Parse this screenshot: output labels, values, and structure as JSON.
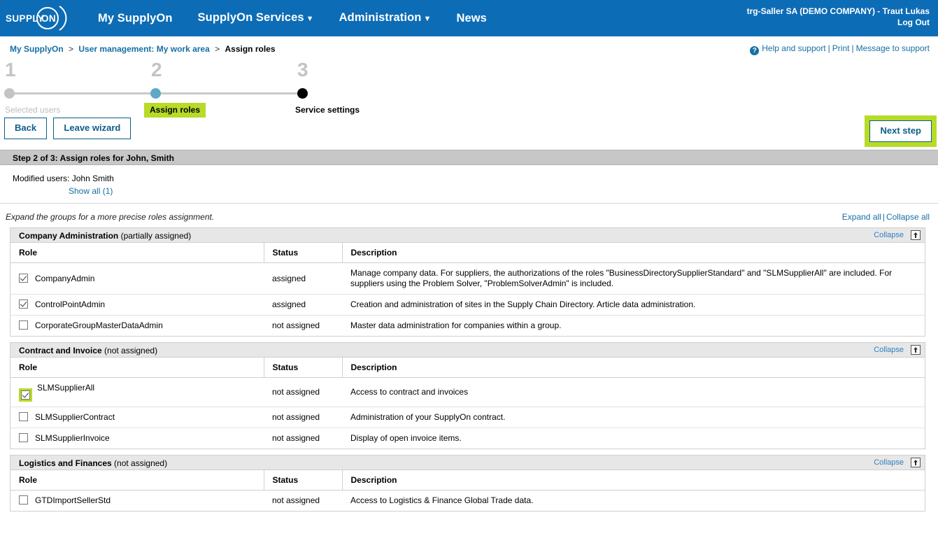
{
  "header": {
    "logo_text": "SUPPLYON",
    "logo_icon": "supplyon-logo",
    "nav": [
      {
        "label": "My SupplyOn",
        "has_caret": false
      },
      {
        "label": "SupplyOn Services",
        "has_caret": true
      },
      {
        "label": "Administration",
        "has_caret": true
      },
      {
        "label": "News",
        "has_caret": false
      }
    ],
    "user_line": "trg-Saller SA (DEMO COMPANY) - Traut Lukas",
    "logout_label": "Log Out",
    "brand_blue": "#0d6cb6"
  },
  "breadcrumb": {
    "items": [
      {
        "label": "My SupplyOn",
        "current": false
      },
      {
        "label": "User management: My work area",
        "current": false
      },
      {
        "label": "Assign roles",
        "current": true
      }
    ],
    "separator": ">"
  },
  "toolbar_links": {
    "help_icon": "question-mark-icon",
    "help": "Help and support",
    "print": "Print",
    "message": "Message to support",
    "separator": "|"
  },
  "steps": {
    "highlight_color": "#b7db27",
    "items": [
      {
        "number": "1",
        "label": "Selected users",
        "state": "done",
        "dot_color": "#c4c4c4"
      },
      {
        "number": "2",
        "label": "Assign roles",
        "state": "current",
        "dot_color": "#5fa8c8"
      },
      {
        "number": "3",
        "label": "Service settings",
        "state": "upcoming",
        "dot_color": "#000000"
      }
    ]
  },
  "actions": {
    "back": "Back",
    "leave_wizard": "Leave wizard",
    "next_step": "Next step"
  },
  "step_band": {
    "title": "Step 2 of 3: Assign roles for John, Smith"
  },
  "modified_users": {
    "label": "Modified users:",
    "value": "John Smith",
    "show_all": "Show all (1)"
  },
  "hint": {
    "text": "Expand the groups for a more precise roles assignment.",
    "expand_all": "Expand all",
    "collapse_all": "Collapse all",
    "separator": "|"
  },
  "table_headers": {
    "role": "Role",
    "status": "Status",
    "description": "Description"
  },
  "groups": [
    {
      "name": "Company Administration",
      "state": "(partially assigned)",
      "collapse_label": "Collapse",
      "collapse_icon": "collapse-up-icon",
      "rows": [
        {
          "role": "CompanyAdmin",
          "checked": true,
          "highlighted": false,
          "status": "assigned",
          "description": "Manage company data. For suppliers, the authorizations of the roles \"BusinessDirectorySupplierStandard\" and \"SLMSupplierAll\" are included. For suppliers using the Problem Solver, \"ProblemSolverAdmin\" is included."
        },
        {
          "role": "ControlPointAdmin",
          "checked": true,
          "highlighted": false,
          "status": "assigned",
          "description": "Creation and administration of sites in the Supply Chain Directory. Article data administration."
        },
        {
          "role": "CorporateGroupMasterDataAdmin",
          "checked": false,
          "highlighted": false,
          "status": "not assigned",
          "description": "Master data administration for companies within a group."
        }
      ]
    },
    {
      "name": "Contract and Invoice",
      "state": "(not assigned)",
      "collapse_label": "Collapse",
      "collapse_icon": "collapse-up-icon",
      "rows": [
        {
          "role": "SLMSupplierAll",
          "checked": true,
          "highlighted": true,
          "status": "not assigned",
          "description": "Access to contract and invoices"
        },
        {
          "role": "SLMSupplierContract",
          "checked": false,
          "highlighted": false,
          "status": "not assigned",
          "description": "Administration of your SupplyOn contract."
        },
        {
          "role": "SLMSupplierInvoice",
          "checked": false,
          "highlighted": false,
          "status": "not assigned",
          "description": "Display of open invoice items."
        }
      ]
    },
    {
      "name": "Logistics and Finances",
      "state": "(not assigned)",
      "collapse_label": "Collapse",
      "collapse_icon": "collapse-up-icon",
      "rows": [
        {
          "role": "GTDImportSellerStd",
          "checked": false,
          "highlighted": false,
          "status": "not assigned",
          "description": "Access to Logistics & Finance Global Trade data."
        }
      ]
    }
  ]
}
